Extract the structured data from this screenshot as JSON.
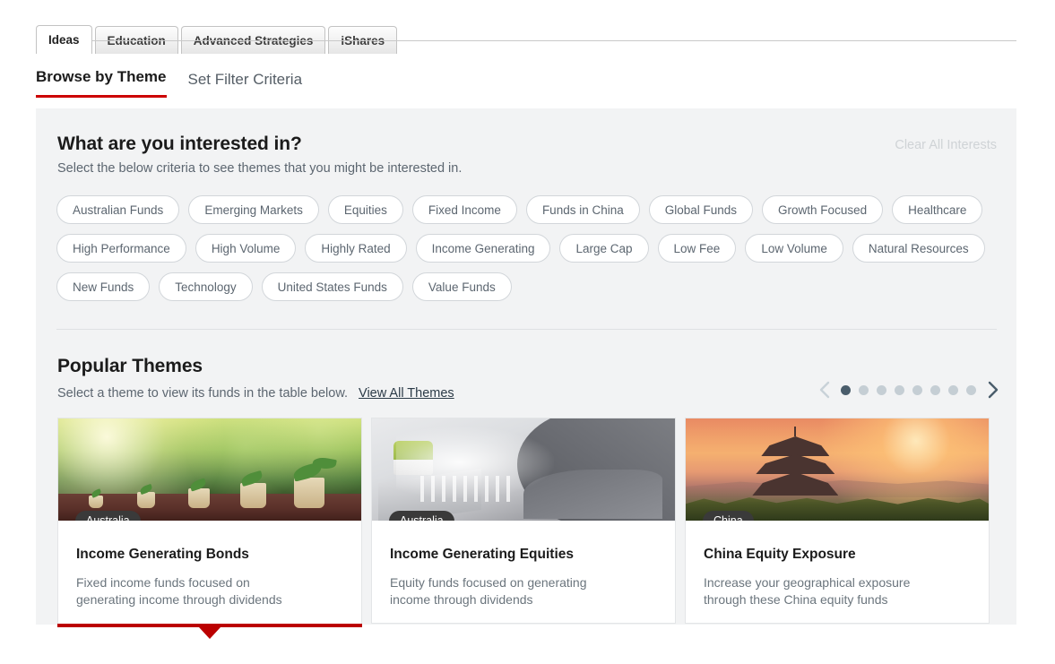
{
  "top_tabs": [
    {
      "label": "Ideas",
      "active": true
    },
    {
      "label": "Education",
      "active": false
    },
    {
      "label": "Advanced Strategies",
      "active": false
    },
    {
      "label": "iShares",
      "active": false
    }
  ],
  "sub_tabs": [
    {
      "label": "Browse by Theme",
      "active": true
    },
    {
      "label": "Set Filter Criteria",
      "active": false
    }
  ],
  "interests": {
    "heading": "What are you interested in?",
    "subheading": "Select the below criteria to see themes that you might be interested in.",
    "clear_all_label": "Clear All Interests",
    "chips": [
      "Australian Funds",
      "Emerging Markets",
      "Equities",
      "Fixed Income",
      "Funds in China",
      "Global Funds",
      "Growth Focused",
      "Healthcare",
      "High Performance",
      "High Volume",
      "Highly Rated",
      "Income Generating",
      "Large Cap",
      "Low Fee",
      "Low Volume",
      "Natural Resources",
      "New Funds",
      "Technology",
      "United States Funds",
      "Value Funds"
    ]
  },
  "popular_themes": {
    "heading": "Popular Themes",
    "subheading": "Select a theme to view its funds in the table below.",
    "view_all_label": "View All Themes",
    "carousel": {
      "prev_icon": "chevron-left-icon",
      "next_icon": "chevron-right-icon",
      "dot_count": 8,
      "active_dot_index": 0,
      "prev_enabled": false,
      "next_enabled": true
    },
    "cards": [
      {
        "badge": "Australia",
        "title": "Income Generating Bonds",
        "description": "Fixed income funds focused on generating income through dividends",
        "selected": true,
        "image": "money-plants-growing-photo"
      },
      {
        "badge": "Australia",
        "title": "Income Generating Equities",
        "description": "Equity funds focused on generating income through dividends",
        "selected": false,
        "image": "person-typing-laptop-photo"
      },
      {
        "badge": "China",
        "title": "China Equity Exposure",
        "description": "Increase your geographical exposure through these China equity funds",
        "selected": false,
        "image": "pagoda-sunset-photo"
      }
    ]
  },
  "colors": {
    "accent_red": "#cc0000",
    "selected_bar_red": "#bb0000",
    "panel_bg": "#f2f3f4",
    "text_dark": "#1b1b1b",
    "text_muted": "#5c6670",
    "disabled_gray": "#cfd3d6",
    "dot_active": "#4a5d6b",
    "dot_inactive": "#c5ced4"
  }
}
